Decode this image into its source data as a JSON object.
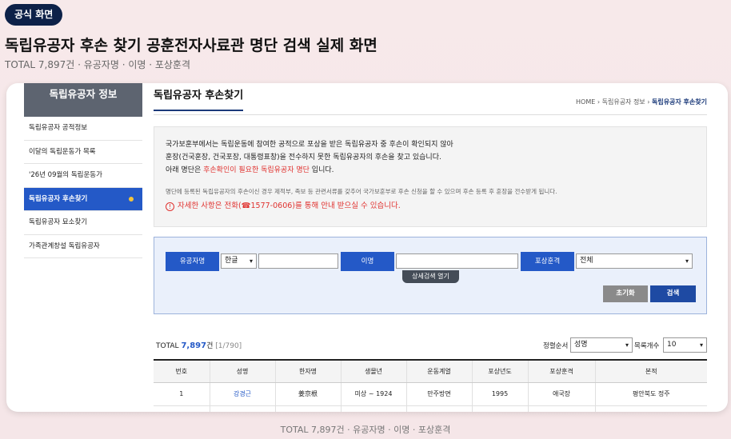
{
  "badge": "공식 화면",
  "headline": "독립유공자 후손 찾기 공훈전자사료관 명단 검색 실제 화면",
  "subline": "TOTAL 7,897건 · 유공자명 · 이명 · 포상훈격",
  "sidebar": {
    "title": "독립유공자 정보",
    "items": [
      {
        "label": "독립유공자 공적정보"
      },
      {
        "label": "이달의 독립운동가 목록"
      },
      {
        "label": "'26년 09월의 독립운동가"
      },
      {
        "label": "독립유공자 후손찾기"
      },
      {
        "label": "독립유공자 묘소찾기"
      },
      {
        "label": "가족관계창설 독립유공자"
      }
    ]
  },
  "main": {
    "title": "독립유공자 후손찾기",
    "breadcrumb": {
      "home": "HOME",
      "sep": "›",
      "parent": "독립유공자 정보",
      "current": "독립유공자 후손찾기"
    }
  },
  "notice": {
    "line1": "국가보훈부에서는 독립운동에 참여한 공적으로 포상을 받은 독립유공자 중 후손이 확인되지 않아",
    "line2": "훈장(건국훈장, 건국포장, 대통령표창)을 전수하지 못한 독립유공자의 후손을 찾고 있습니다.",
    "line3_pre": "아래 명단은 ",
    "line3_red": "후손확인이 필요한 독립유공자 명단",
    "line3_post": " 입니다.",
    "small": "명단에 등록된 독립유공자의 후손이신 경우 제적부, 족보 등 관련서류를 갖추어 국가보훈부로 후손 신청을 할 수 있으며 후손 등록 후 훈장을 전수받게 됩니다.",
    "warn": "자세한 사항은 전화(☎1577-0606)를 통해 안내 받으실 수 있습니다."
  },
  "search": {
    "name_label": "유공자명",
    "lang_value": "한글",
    "name_value": "",
    "alias_label": "이명",
    "alias_value": "",
    "rank_label": "포상훈격",
    "rank_value": "전체",
    "advanced": "상세검색 열기",
    "reset": "초기화",
    "submit": "검색"
  },
  "results": {
    "total_label": "TOTAL",
    "total_count": "7,897",
    "total_unit": "건",
    "page_info": "[1/790]",
    "sort_label": "정렬순서",
    "sort_value": "성명",
    "per_page_label": "목록개수",
    "per_page_value": "10"
  },
  "table": {
    "columns": [
      "번호",
      "성명",
      "한자명",
      "생몰년",
      "운동계열",
      "포상년도",
      "포상훈격",
      "본적"
    ],
    "rows": [
      [
        "1",
        "강경근",
        "姜京根",
        "미상 ~ 1924",
        "만주방면",
        "1995",
        "애국장",
        "평안북도  정주"
      ]
    ]
  },
  "footer": "TOTAL 7,897건 · 유공자명 · 이명 · 포상훈격",
  "colors": {
    "navy": "#0d2148",
    "blue": "#2459c7",
    "red": "#e0322f",
    "gray_btn": "#8a8a8a",
    "submit_btn": "#1e4aa3"
  }
}
